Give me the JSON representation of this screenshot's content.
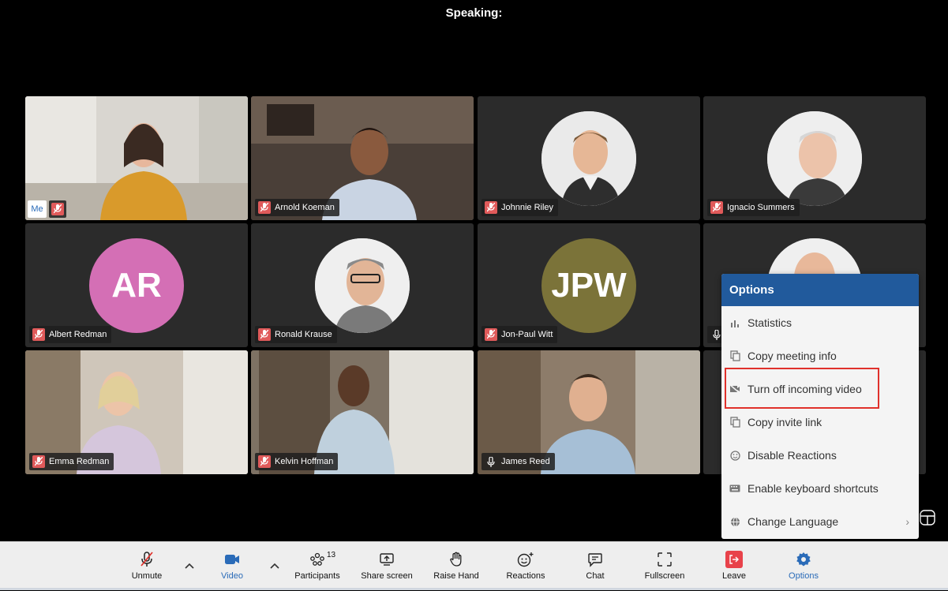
{
  "header": {
    "speaking_label": "Speaking:"
  },
  "tiles": [
    {
      "name": "",
      "me_label": "Me",
      "kind": "video"
    },
    {
      "name": "Arnold Koeman",
      "kind": "video"
    },
    {
      "name": "Johnnie Riley",
      "kind": "photo-avatar"
    },
    {
      "name": "Ignacio Summers",
      "kind": "photo-avatar"
    },
    {
      "name": "Albert Redman",
      "initials": "AR",
      "kind": "initials",
      "color": "#d46fb5"
    },
    {
      "name": "Ronald Krause",
      "kind": "photo-avatar"
    },
    {
      "name": "Jon-Paul Witt",
      "initials": "JPW",
      "kind": "initials",
      "color": "#7b7339"
    },
    {
      "name": "",
      "kind": "photo-avatar"
    },
    {
      "name": "Emma Redman",
      "kind": "video"
    },
    {
      "name": "Kelvin Hoffman",
      "kind": "video"
    },
    {
      "name": "James Reed",
      "kind": "video"
    }
  ],
  "options_menu": {
    "title": "Options",
    "items": [
      {
        "label": "Statistics",
        "icon": "bar-chart-icon"
      },
      {
        "label": "Copy meeting info",
        "icon": "copy-icon"
      },
      {
        "label": "Turn off incoming video",
        "icon": "video-off-icon"
      },
      {
        "label": "Copy invite link",
        "icon": "copy-icon"
      },
      {
        "label": "Disable Reactions",
        "icon": "smiley-icon"
      },
      {
        "label": "Enable keyboard shortcuts",
        "icon": "keyboard-icon"
      },
      {
        "label": "Change Language",
        "icon": "globe-icon"
      }
    ]
  },
  "toolbar": {
    "unmute": "Unmute",
    "video": "Video",
    "participants": "Participants",
    "participants_count": "13",
    "share_screen": "Share screen",
    "raise_hand": "Raise Hand",
    "reactions": "Reactions",
    "chat": "Chat",
    "fullscreen": "Fullscreen",
    "leave": "Leave",
    "options": "Options"
  },
  "colors": {
    "accent": "#215a9c",
    "muted_red": "#e05a5a",
    "leave_red": "#e8424a",
    "highlight": "#e0312b"
  }
}
